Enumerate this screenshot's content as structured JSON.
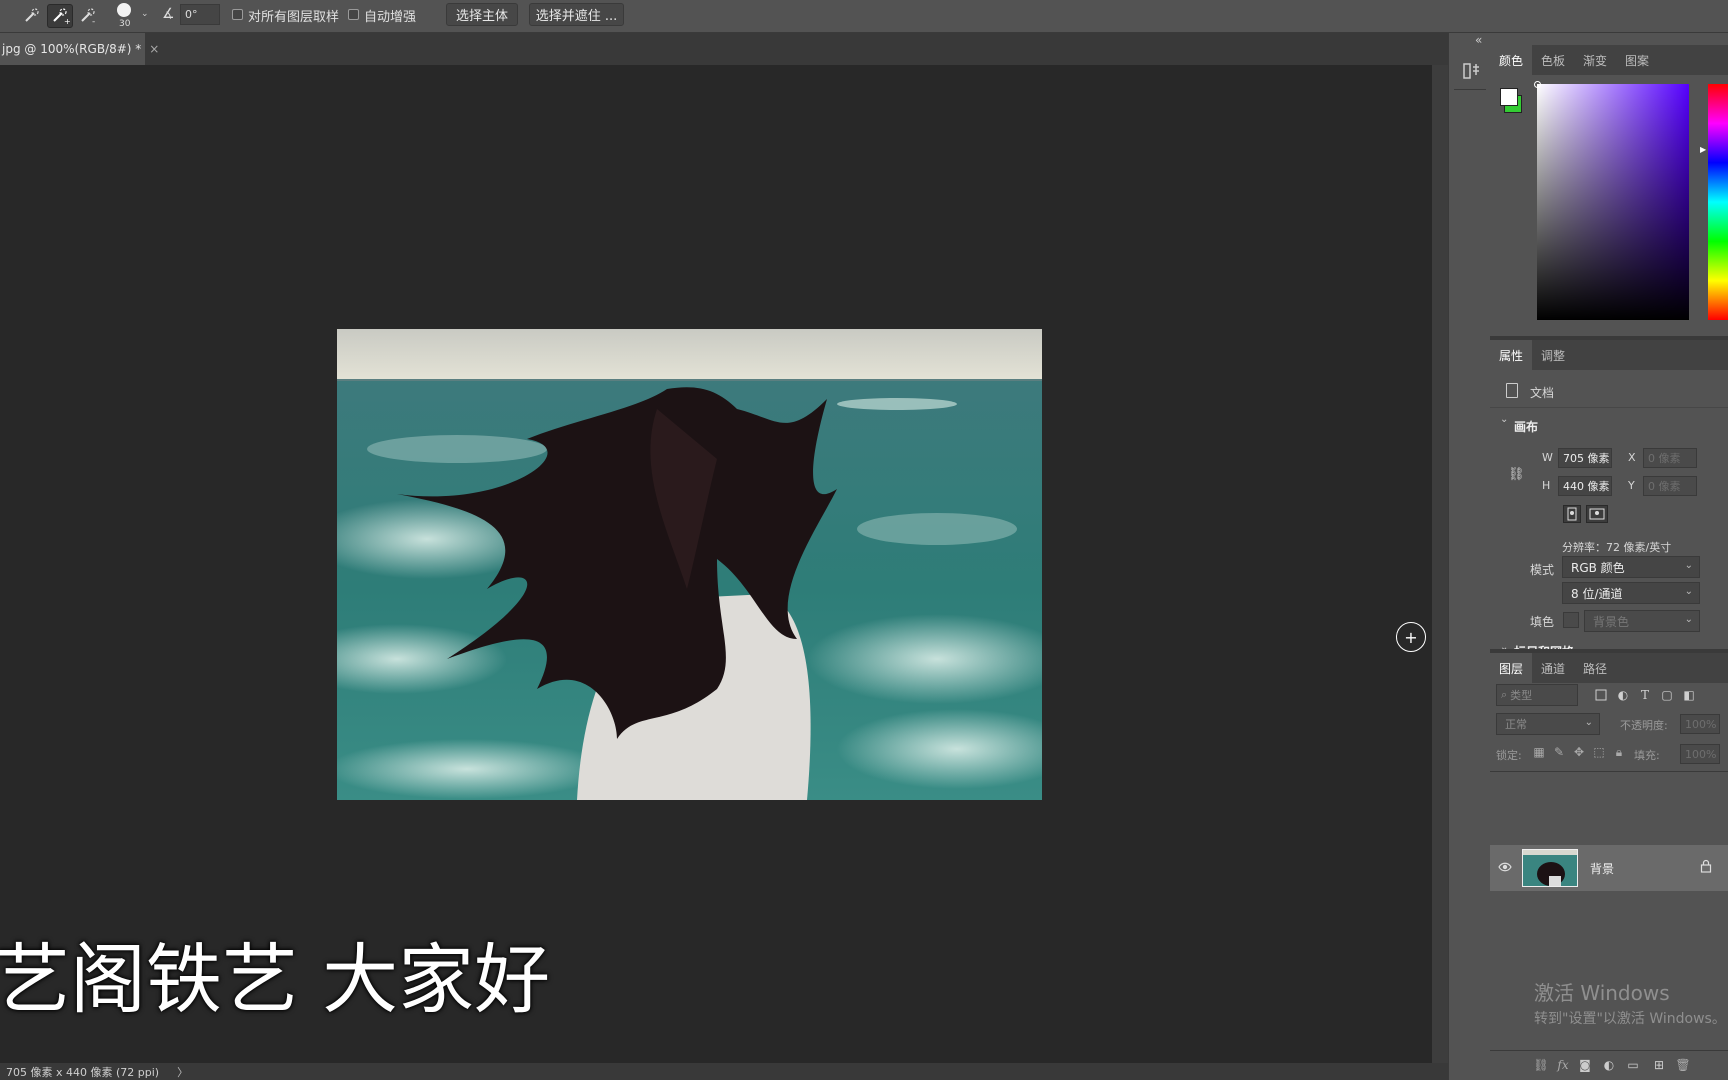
{
  "options_bar": {
    "brush_size": "30",
    "angle_value": "0°",
    "sample_all_layers_label": "对所有图层取样",
    "auto_enhance_label": "自动增强",
    "select_subject_label": "选择主体",
    "select_and_mask_label": "选择并遮住 ..."
  },
  "document_tab": {
    "title": "jpg @ 100%(RGB/8#) *",
    "close_glyph": "×"
  },
  "subtitle": "艺阁铁艺 大家好",
  "status_bar": {
    "info": "705 像素 x 440 像素 (72 ppi)",
    "arrow": "〉"
  },
  "color_panel": {
    "tabs": [
      "颜色",
      "色板",
      "渐变",
      "图案"
    ],
    "foreground_color": "#ffffff",
    "background_color": "#33cc33"
  },
  "properties_panel": {
    "tabs": [
      "属性",
      "调整"
    ],
    "doc_label": "文档",
    "canvas_section": "画布",
    "w_label": "W",
    "w_value": "705 像素",
    "h_label": "H",
    "h_value": "440 像素",
    "x_label": "X",
    "x_placeholder": "0 像素",
    "y_label": "Y",
    "y_placeholder": "0 像素",
    "resolution": "分辨率：72 像素/英寸",
    "mode_label": "模式",
    "mode_value": "RGB 颜色",
    "depth_value": "8 位/通道",
    "fill_label": "填色",
    "fill_value": "背景色",
    "next_section": "标尺和网格"
  },
  "layers_panel": {
    "tabs": [
      "图层",
      "通道",
      "路径"
    ],
    "filter_placeholder": "类型",
    "blend_mode": "正常",
    "opacity_label": "不透明度:",
    "opacity_value": "100%",
    "lock_label": "锁定:",
    "fill_label": "填充:",
    "fill_value": "100%",
    "layers": [
      {
        "name": "背景",
        "visible": true,
        "locked": true
      }
    ]
  },
  "windows_watermark": {
    "line1": "激活 Windows",
    "line2": "转到\"设置\"以激活 Windows。"
  }
}
